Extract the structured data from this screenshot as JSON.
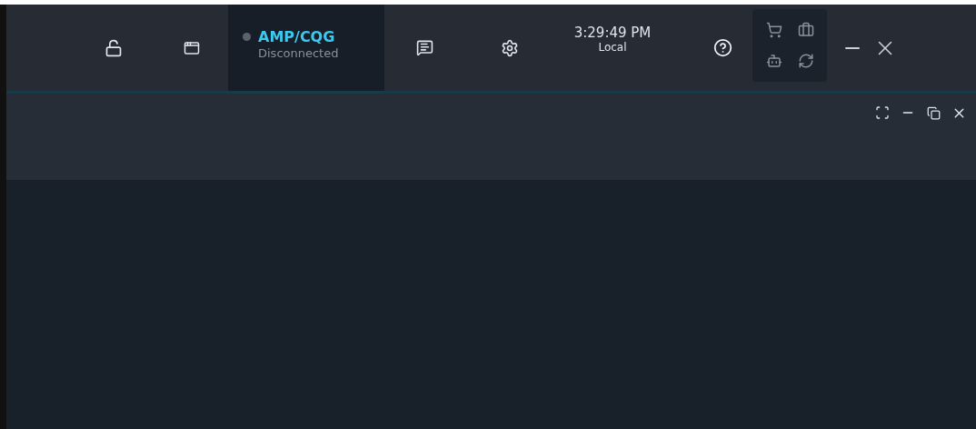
{
  "connection": {
    "name": "AMP/CQG",
    "status": "Disconnected",
    "connected": false
  },
  "clock": {
    "time": "3:29:49 PM",
    "zone": "Local"
  }
}
